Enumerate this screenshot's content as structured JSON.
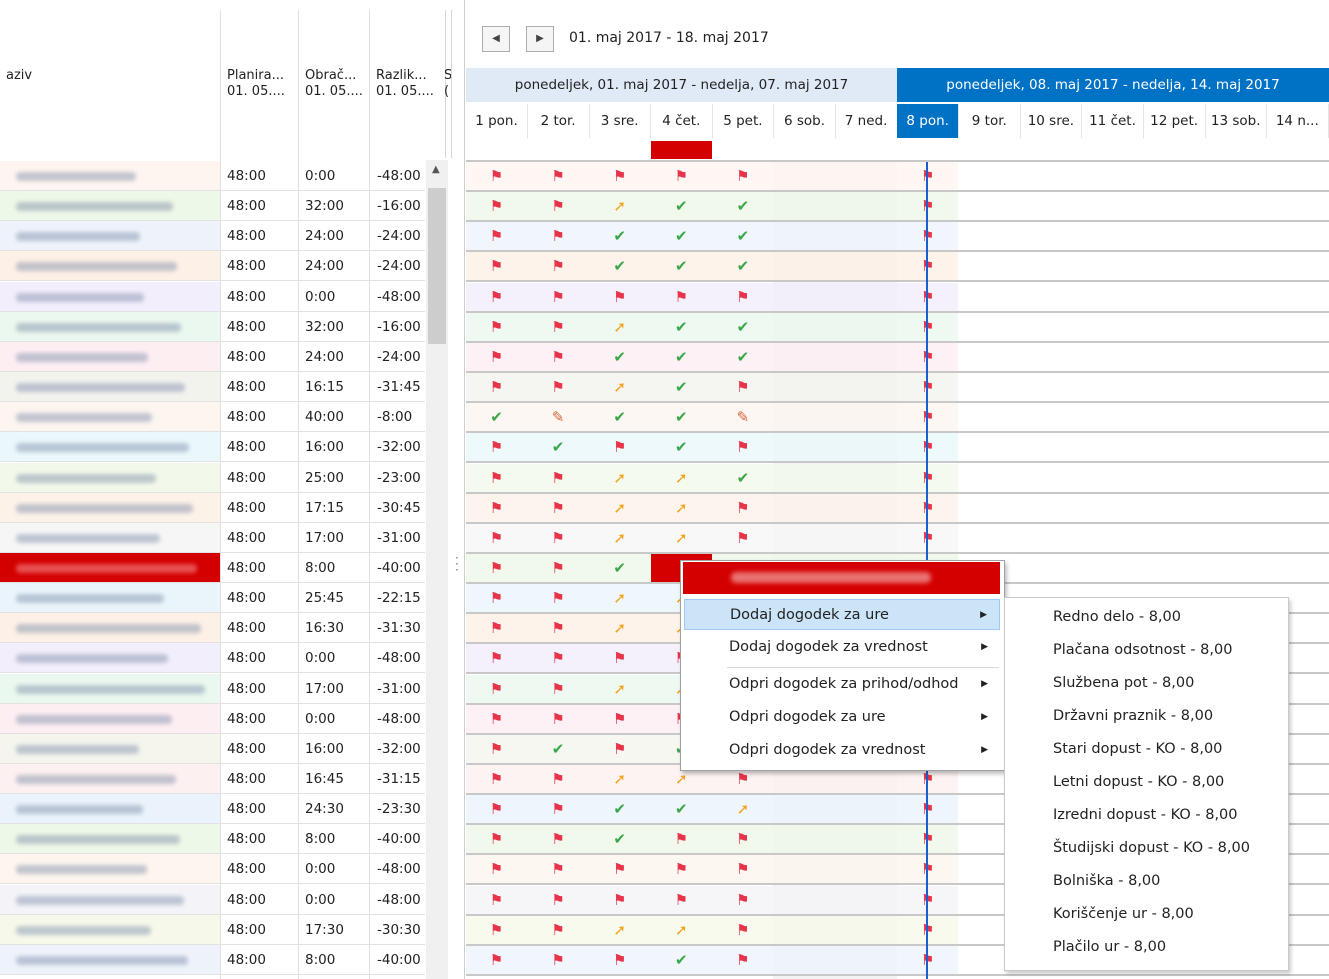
{
  "left_grid": {
    "columns": [
      {
        "name": "name",
        "title": "aziv",
        "sub": ""
      },
      {
        "name": "planned",
        "title": "Planira...",
        "sub": "01. 05...."
      },
      {
        "name": "computed",
        "title": "Obrač...",
        "sub": "01. 05...."
      },
      {
        "name": "difference",
        "title": "Razlik...",
        "sub": "01. 05...."
      },
      {
        "name": "extra",
        "title": "S",
        "sub": "("
      }
    ],
    "rows": [
      {
        "planned": "48:00",
        "computed": "0:00",
        "diff": "-48:00"
      },
      {
        "planned": "48:00",
        "computed": "32:00",
        "diff": "-16:00"
      },
      {
        "planned": "48:00",
        "computed": "24:00",
        "diff": "-24:00"
      },
      {
        "planned": "48:00",
        "computed": "24:00",
        "diff": "-24:00"
      },
      {
        "planned": "48:00",
        "computed": "0:00",
        "diff": "-48:00"
      },
      {
        "planned": "48:00",
        "computed": "32:00",
        "diff": "-16:00"
      },
      {
        "planned": "48:00",
        "computed": "24:00",
        "diff": "-24:00"
      },
      {
        "planned": "48:00",
        "computed": "16:15",
        "diff": "-31:45"
      },
      {
        "planned": "48:00",
        "computed": "40:00",
        "diff": "-8:00"
      },
      {
        "planned": "48:00",
        "computed": "16:00",
        "diff": "-32:00"
      },
      {
        "planned": "48:00",
        "computed": "25:00",
        "diff": "-23:00"
      },
      {
        "planned": "48:00",
        "computed": "17:15",
        "diff": "-30:45"
      },
      {
        "planned": "48:00",
        "computed": "17:00",
        "diff": "-31:00"
      },
      {
        "planned": "48:00",
        "computed": "8:00",
        "diff": "-40:00"
      },
      {
        "planned": "48:00",
        "computed": "25:45",
        "diff": "-22:15"
      },
      {
        "planned": "48:00",
        "computed": "16:30",
        "diff": "-31:30"
      },
      {
        "planned": "48:00",
        "computed": "0:00",
        "diff": "-48:00"
      },
      {
        "planned": "48:00",
        "computed": "17:00",
        "diff": "-31:00"
      },
      {
        "planned": "48:00",
        "computed": "0:00",
        "diff": "-48:00"
      },
      {
        "planned": "48:00",
        "computed": "16:00",
        "diff": "-32:00"
      },
      {
        "planned": "48:00",
        "computed": "16:45",
        "diff": "-31:15"
      },
      {
        "planned": "48:00",
        "computed": "24:30",
        "diff": "-23:30"
      },
      {
        "planned": "48:00",
        "computed": "8:00",
        "diff": "-40:00"
      },
      {
        "planned": "48:00",
        "computed": "0:00",
        "diff": "-48:00"
      },
      {
        "planned": "48:00",
        "computed": "0:00",
        "diff": "-48:00"
      },
      {
        "planned": "48:00",
        "computed": "17:30",
        "diff": "-30:30"
      },
      {
        "planned": "48:00",
        "computed": "8:00",
        "diff": "-40:00"
      }
    ]
  },
  "scheduler": {
    "date_range": "01. maj 2017 - 18. maj 2017",
    "prev_icon": "triangle-left-icon",
    "next_icon": "triangle-right-icon",
    "weeks": [
      {
        "label": "ponedeljek, 01. maj 2017 - nedelja, 07. maj 2017",
        "selected": false
      },
      {
        "label": "ponedeljek, 08. maj 2017 - nedelja, 14. maj 2017",
        "selected": true
      }
    ],
    "days": [
      "1 pon.",
      "2 tor.",
      "3 sre.",
      "4 čet.",
      "5 pet.",
      "6 sob.",
      "7 ned.",
      "8 pon.",
      "9 tor.",
      "10 sre.",
      "11 čet.",
      "12 pet.",
      "13 sob.",
      "14 n..."
    ],
    "status_rows": [
      "FFFFF",
      "FFACC",
      "FFCCC",
      "FFCCC",
      "FFFFF",
      "FFACC",
      "FFCCC",
      "FFACF",
      "CDCCD",
      "FCFCF",
      "FFAAC",
      "FFAAF",
      "FFAAF",
      "FFCFF",
      "FFAAF",
      "FFAAF",
      "FFFFF",
      "FFAAF",
      "FFFFF",
      "FCFCF",
      "FFAAF",
      "FFCCA",
      "FFCFF",
      "FFFFF",
      "FFFFF",
      "FFAAF",
      "FFFCF"
    ],
    "colors": {
      "selected_week": "#0072c6",
      "week_header": "#dfeaf6",
      "flag": "#e8344a",
      "check": "#3aa84a",
      "arrow": "#f2a31b",
      "today_line": "#1a5fd0"
    }
  },
  "context_menu": {
    "items": [
      {
        "label": "Dodaj dogodek za ure",
        "has_sub": true,
        "highlighted": true
      },
      {
        "label": "Dodaj dogodek za vrednost",
        "has_sub": true,
        "highlighted": false
      },
      {
        "label": "Odpri dogodek za prihod/odhod",
        "has_sub": true,
        "highlighted": false
      },
      {
        "label": "Odpri dogodek za ure",
        "has_sub": true,
        "highlighted": false
      },
      {
        "label": "Odpri dogodek za vrednost",
        "has_sub": true,
        "highlighted": false
      }
    ],
    "submenu": [
      "Redno delo - 8,00",
      "Plačana odsotnost - 8,00",
      "Službena pot - 8,00",
      "Državni praznik - 8,00",
      "Stari dopust - KO - 8,00",
      "Letni dopust - KO - 8,00",
      "Izredni dopust - KO - 8,00",
      "Študijski dopust - KO - 8,00",
      "Bolniška - 8,00",
      "Koriščenje ur - 8,00",
      "Plačilo ur - 8,00"
    ]
  }
}
